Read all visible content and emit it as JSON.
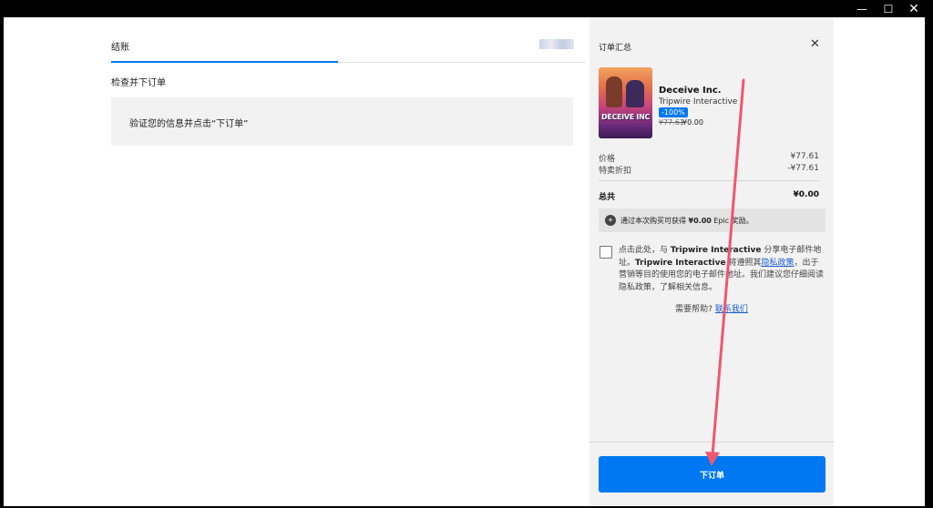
{
  "window": {
    "controls": {
      "minimize": "—",
      "maximize": "☐",
      "close": "✕"
    }
  },
  "left": {
    "tab": "结账",
    "section_title": "检查并下订单",
    "info_text": "验证您的信息并点击“下订单”"
  },
  "summary": {
    "title": "订单汇总",
    "close_glyph": "✕",
    "thumb_logo": "DECEIVE INC",
    "product": {
      "name": "Deceive Inc.",
      "developer": "Tripwire Interactive",
      "discount": "-100%",
      "price_old": "¥77.61",
      "price_new": "¥0.00"
    },
    "rows": {
      "price_label": "价格",
      "price_value": "¥77.61",
      "discount_label": "特卖折扣",
      "discount_value": "-¥77.61",
      "total_label": "总共",
      "total_value": "¥0.00"
    },
    "reward": {
      "prefix": "通过本次购买可获得",
      "amount": "¥0.00",
      "suffix": "Epic 奖励。"
    },
    "consent": {
      "p1": "点击此处，与",
      "company1": "Tripwire Interactive",
      "p2": "分享电子邮件地址。",
      "company2": "Tripwire Interactive",
      "p3": "将遵照其",
      "link": "隐私政策",
      "p4": "，出于营销等目的使用您的电子邮件地址。我们建议您仔细阅读隐私政策，了解相关信息。"
    },
    "help": {
      "prefix": "需要帮助?",
      "link": "联系我们"
    },
    "order_button": "下订单"
  },
  "annotation_color": "#f0566e"
}
